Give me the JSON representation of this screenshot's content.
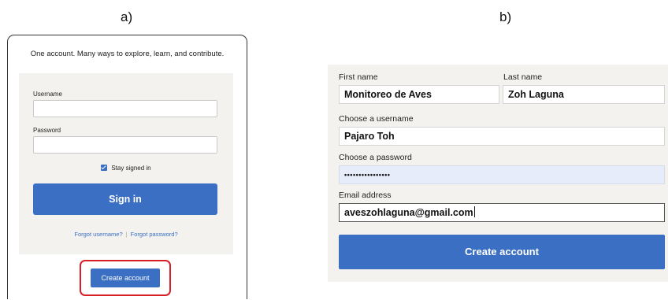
{
  "panels": {
    "a_label": "a)",
    "b_label": "b)"
  },
  "login": {
    "tagline": "One account. Many ways to explore, learn, and contribute.",
    "username_label": "Username",
    "username_value": "",
    "password_label": "Password",
    "password_value": "",
    "stay_signed_in": "Stay signed in",
    "stay_signed_in_checked": true,
    "sign_in": "Sign in",
    "forgot_username": "Forgot username?",
    "separator": "|",
    "forgot_password": "Forgot password?",
    "create_account": "Create account"
  },
  "signup": {
    "first_name_label": "First name",
    "first_name_value": "Monitoreo de Aves",
    "last_name_label": "Last name",
    "last_name_value": "Zoh Laguna",
    "username_label": "Choose a username",
    "username_value": "Pajaro Toh",
    "password_label": "Choose a password",
    "password_value": "••••••••••••••••",
    "email_label": "Email address",
    "email_value": "aveszohlaguna@gmail.com",
    "create_account": "Create account"
  },
  "colors": {
    "accent": "#3b6fc4",
    "highlight": "#d81f26",
    "form_bg": "#f3f2ee",
    "autofill_bg": "#e6ecf9"
  }
}
